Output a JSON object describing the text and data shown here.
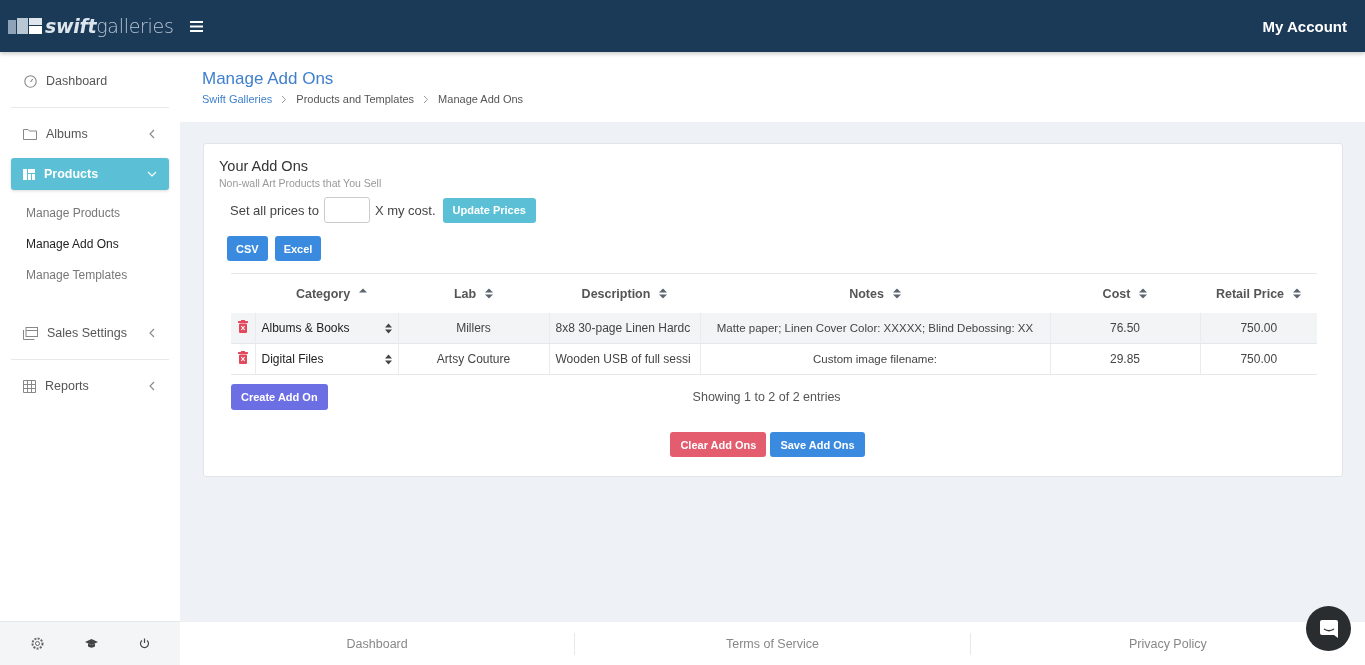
{
  "header": {
    "logo_strong": "swift",
    "logo_light": "galleries",
    "account": "My Account"
  },
  "sidebar": {
    "items": [
      {
        "label": "Dashboard",
        "selected": false
      },
      {
        "label": "Albums",
        "expanded": false,
        "selected": false
      },
      {
        "label": "Products",
        "expanded": true,
        "selected": true,
        "children": [
          {
            "label": "Manage Products",
            "selected": false
          },
          {
            "label": "Manage Add Ons",
            "selected": true
          },
          {
            "label": "Manage Templates",
            "selected": false
          }
        ]
      },
      {
        "label": "Sales Settings",
        "expanded": false,
        "selected": false
      },
      {
        "label": "Reports",
        "expanded": false,
        "selected": false
      }
    ]
  },
  "page": {
    "title": "Manage Add Ons",
    "breadcrumb": [
      {
        "label": "Swift Galleries",
        "link": true
      },
      {
        "label": "Products and Templates",
        "link": false
      },
      {
        "label": "Manage Add Ons",
        "link": false
      }
    ]
  },
  "card": {
    "title": "Your Add Ons",
    "subtitle": "Non-wall Art Products that You Sell",
    "price_prefix": "Set all prices to",
    "price_suffix": "X my cost.",
    "update_button": "Update Prices",
    "export_buttons": [
      "CSV",
      "Excel"
    ],
    "table": {
      "columns": [
        {
          "label": "Category",
          "sorted": true
        },
        {
          "label": "Lab",
          "sorted": false
        },
        {
          "label": "Description",
          "sorted": false
        },
        {
          "label": "Notes",
          "sorted": false
        },
        {
          "label": "Cost",
          "sorted": false
        },
        {
          "label": "Retail Price",
          "sorted": false
        }
      ],
      "rows": [
        {
          "category": "Albums & Books",
          "lab": "Millers",
          "description": "8x8 30-page Linen Hardc",
          "notes": "Matte paper; Linen Cover Color: XXXXX; Blind Debossing: XX",
          "cost": "76.50",
          "retail": "750.00"
        },
        {
          "category": "Digital Files",
          "lab": "Artsy Couture",
          "description": "Wooden USB of full sessi",
          "notes": "Custom image filename:",
          "cost": "29.85",
          "retail": "750.00"
        }
      ]
    },
    "create_button": "Create Add On",
    "info": "Showing 1 to 2 of 2 entries",
    "clear_button": "Clear Add Ons",
    "save_button": "Save Add Ons"
  },
  "footer": {
    "links": [
      "Dashboard",
      "Terms of Service",
      "Privacy Policy"
    ]
  }
}
